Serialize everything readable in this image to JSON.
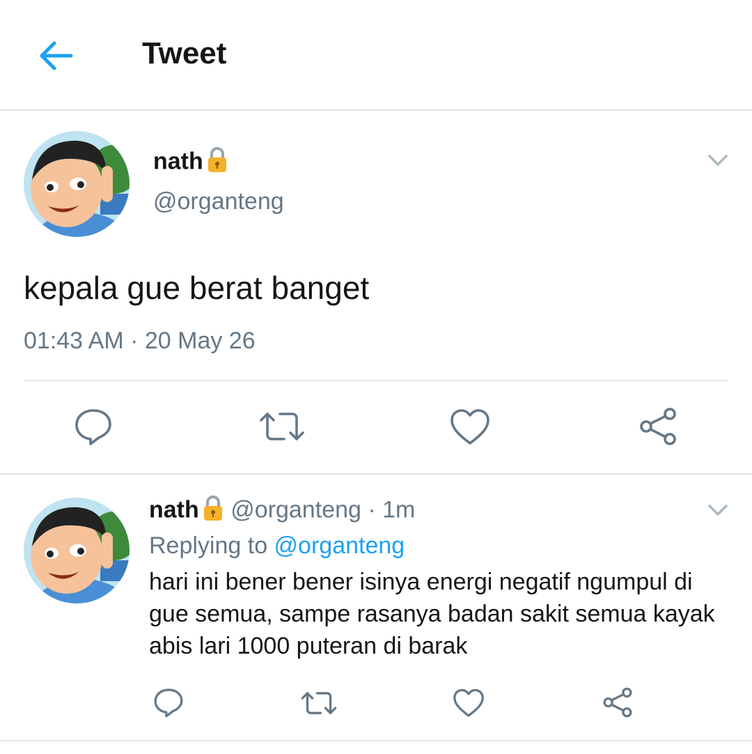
{
  "header": {
    "title": "Tweet"
  },
  "tweet": {
    "author_name": "nath",
    "author_handle": "@organteng",
    "text": "kepala gue berat banget",
    "timestamp": "01:43 AM · 20 May 26"
  },
  "reply": {
    "author_name": "nath",
    "meta": "@organteng · 1m",
    "replying_prefix": "Replying to ",
    "replying_to": "@organteng",
    "text": "hari ini bener bener isinya energi negatif ngumpul di gue semua, sampe rasanya badan sakit semua kayak abis lari 1000 puteran di barak"
  },
  "colors": {
    "accent": "#1da1f2",
    "secondary_text": "#657786",
    "primary_text": "#14171a",
    "divider": "#dfe6ec",
    "icon_gray": "#657786",
    "lock_gold": "#f3b228"
  },
  "icons": [
    "back-arrow-icon",
    "lock-icon",
    "chevron-down-icon",
    "reply-icon",
    "retweet-icon",
    "like-icon",
    "share-icon"
  ]
}
